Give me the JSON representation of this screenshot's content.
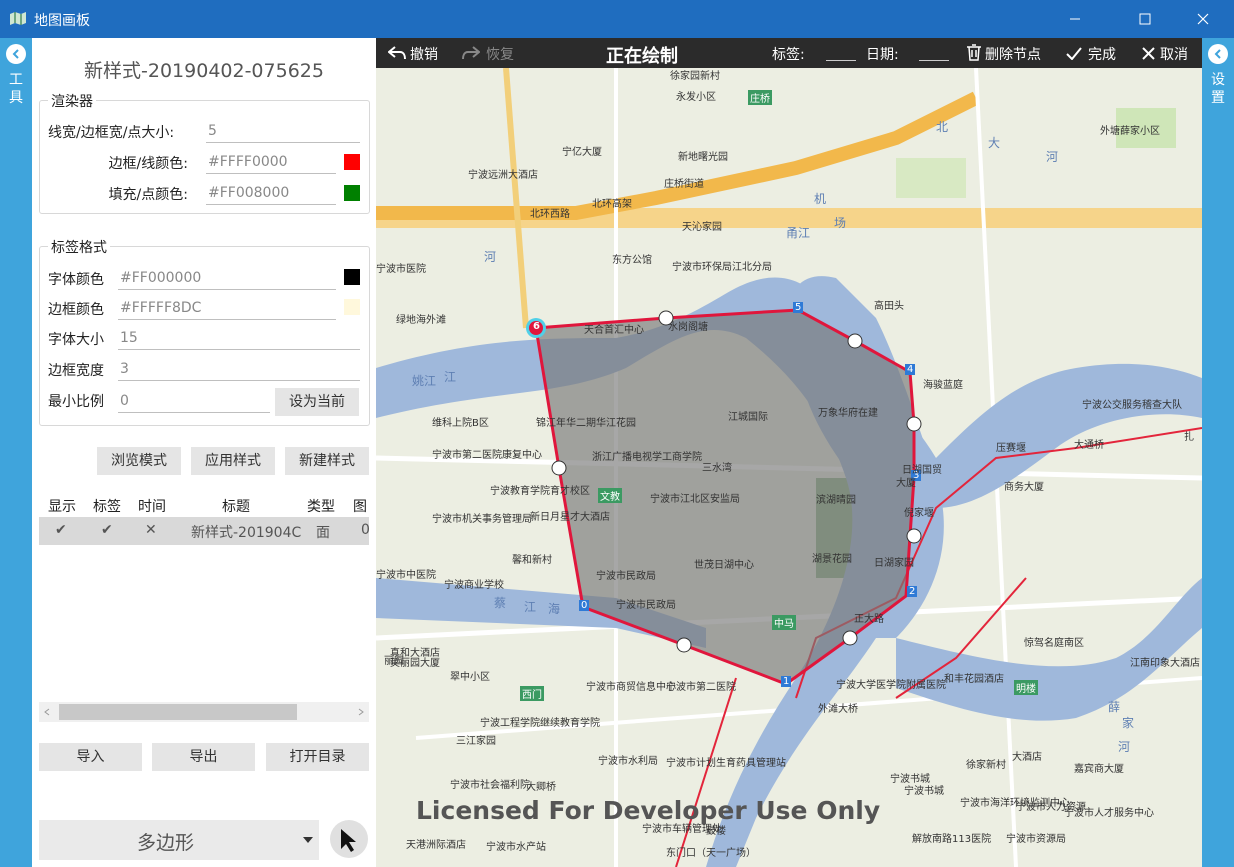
{
  "window": {
    "title": "地图画板"
  },
  "left_strip": {
    "label": "工具"
  },
  "right_strip": {
    "label": "设置"
  },
  "style": {
    "name": "新样式-20190402-075625",
    "renderer_title": "渲染器",
    "line_width_label": "线宽/边框宽/点大小:",
    "line_width_value": "5",
    "stroke_color_label": "边框/线颜色:",
    "stroke_color_value": "#FFFF0000",
    "fill_color_label": "填充/点颜色:",
    "fill_color_value": "#FF008000",
    "stroke_swatch": "#ff0000",
    "fill_swatch": "#008000"
  },
  "label_format": {
    "title": "标签格式",
    "font_color_label": "字体颜色",
    "font_color_value": "#FF000000",
    "font_swatch": "#000000",
    "border_color_label": "边框颜色",
    "border_color_value": "#FFFFF8DC",
    "border_swatch": "#fff8dc",
    "font_size_label": "字体大小",
    "font_size_value": "15",
    "border_width_label": "边框宽度",
    "border_width_value": "3",
    "min_scale_label": "最小比例",
    "min_scale_value": "0",
    "set_current_button": "设为当前"
  },
  "actions": {
    "browse": "浏览模式",
    "apply": "应用样式",
    "new": "新建样式"
  },
  "table": {
    "columns": [
      "显示",
      "标签",
      "时间",
      "标题",
      "类型",
      "图"
    ],
    "rows": [
      {
        "show": "✔",
        "label": "✔",
        "time": "✕",
        "title": "新样式-201904C",
        "type": "面",
        "extra": "0"
      }
    ]
  },
  "io": {
    "import": "导入",
    "export": "导出",
    "open_dir": "打开目录"
  },
  "shape_select": {
    "value": "多边形"
  },
  "toolbar": {
    "undo": "撤销",
    "redo": "恢复",
    "status": "正在绘制",
    "tag_label": "标签:",
    "date_label": "日期:",
    "delete_node": "删除节点",
    "done": "完成",
    "cancel": "取消"
  },
  "map": {
    "watermark": "Licensed For Developer Use Only",
    "vertex_labels": [
      "0",
      "1",
      "2",
      "3",
      "4",
      "5",
      "6"
    ],
    "labels": [
      "徐家园新村",
      "永发小区",
      "庄桥",
      "宁亿大厦",
      "新地曙光园",
      "外塘薛家小区",
      "宁波远洲大酒店",
      "庄桥街道",
      "北环西路",
      "北环高架",
      "天沁家园",
      "东方公馆",
      "宁波市环保局江北分局",
      "宁波市医院",
      "绿地海外滩",
      "天合首汇中心",
      "水岗阁塘",
      "高田头",
      "海骏蓝庭",
      "锦江年华二期华江花园",
      "江城国际",
      "万象华府在建",
      "宁波公交服务稽查大队",
      "维科上院B区",
      "宁波市第二医院康复中心",
      "浙江广播电视学工商学院",
      "三水湾",
      "日湖国贸",
      "压赛堰",
      "大通桥",
      "宁波教育学院育才校区",
      "文教",
      "宁波市江北区安监局",
      "滨湖晴园",
      "倪家堰",
      "新日月星才大酒店",
      "宁波市机关事务管理局",
      "馨和新村",
      "世茂日湖中心",
      "湖景花园",
      "日湖家园",
      "宁波市中医院",
      "宁波商业学校",
      "宁波市民政局",
      "中马",
      "正大路",
      "真和大酒店",
      "美丽园大厦",
      "翠中小区",
      "宁波市商贸信息中心",
      "宁波市第二医院",
      "宁波大学医学院附属医院",
      "外滩大桥",
      "惊驾名庭南区",
      "和丰花园酒店",
      "明楼",
      "江南印象大酒店",
      "西门",
      "宁波工程学院继续教育学院",
      "宁波市水利局",
      "宁波市计划生育药具管理站",
      "宁波市社会福利院",
      "大卿桥",
      "宁波市车辆管理处",
      "天港洲际酒店",
      "鼓楼",
      "东门口（天一广场）",
      "解放南路113医院",
      "宁波市海洋环境监测中心",
      "宁波市资源局",
      "徐家新村",
      "嘉宾商大厦",
      "宁波市人才服务中心",
      "宁波书城",
      "姚江",
      "江",
      "河",
      "北",
      "大",
      "机",
      "场",
      "甬江",
      "蔡",
      "江",
      "海",
      "河",
      "薛",
      "家",
      "河",
      "三江家园",
      "扎",
      "大厦",
      "宁波市人力资源",
      "商务大厦",
      "宁波市民政局",
      "宁波书城",
      "大酒店",
      "丽园",
      "宁波市水产站"
    ]
  }
}
